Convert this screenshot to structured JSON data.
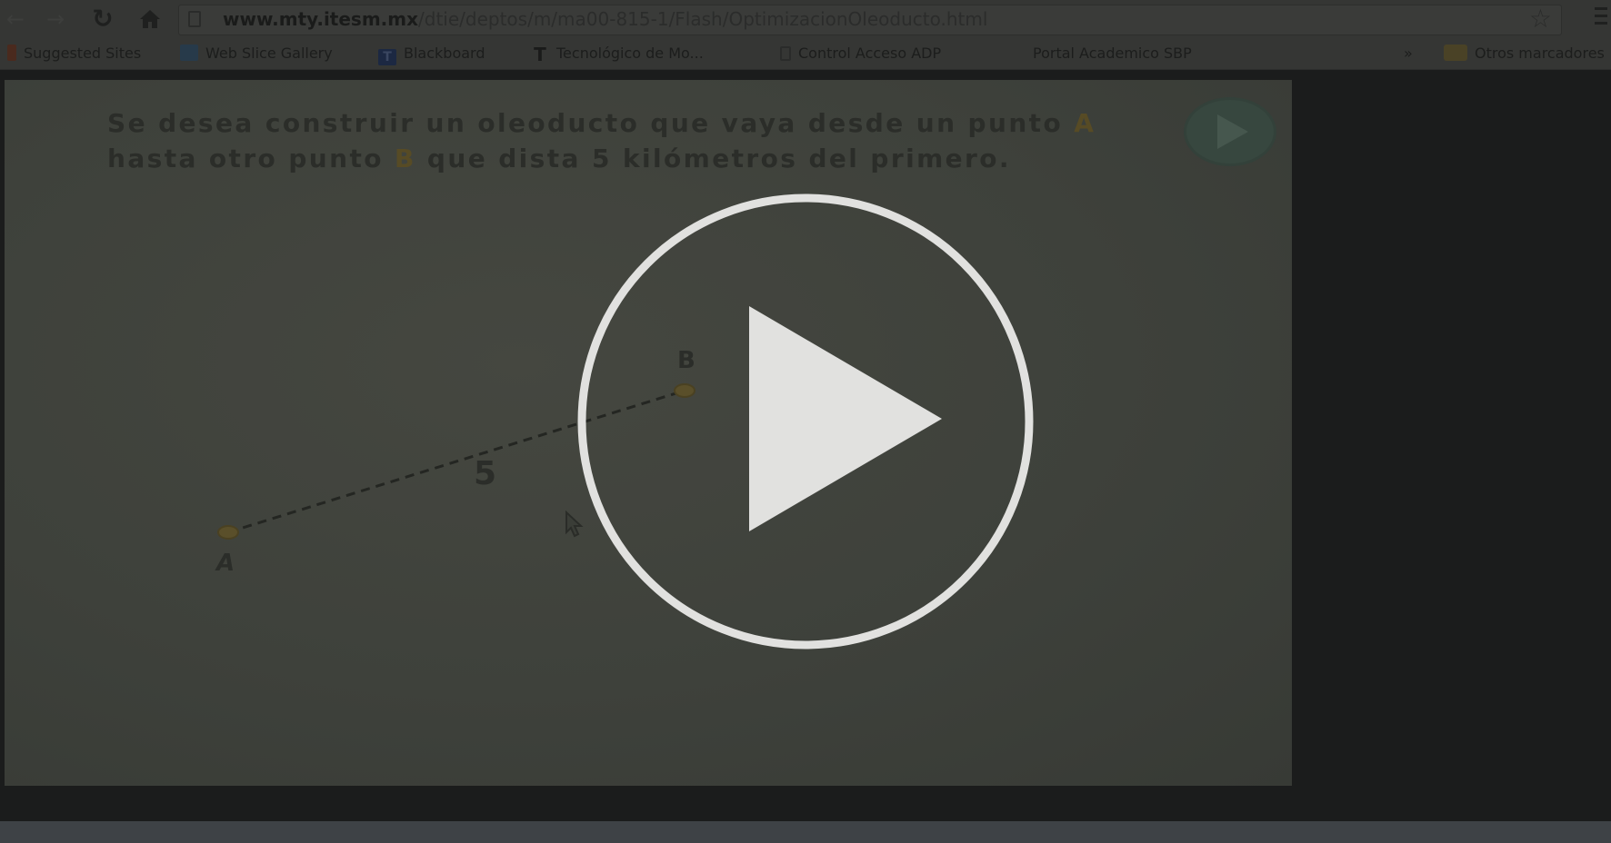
{
  "browser": {
    "url_host": "www.mty.itesm.mx",
    "url_path": "/dtie/deptos/m/ma00-815-1/Flash/OptimizacionOleoducto.html",
    "icons": {
      "back": "back-arrow-icon",
      "forward": "forward-arrow-icon",
      "reload": "reload-icon",
      "home": "home-icon",
      "star": "star-icon",
      "menu": "menu-icon"
    }
  },
  "bookmarks": {
    "items": [
      {
        "label": "Suggested Sites"
      },
      {
        "label": "Web Slice Gallery"
      },
      {
        "label": "Blackboard",
        "icon_text": "T"
      },
      {
        "label": "Tecnológico de Mo...",
        "icon_text": "T"
      },
      {
        "label": "Control Acceso ADP"
      },
      {
        "label": "Portal Academico SBP"
      }
    ],
    "more": "»",
    "others": "Otros marcadores"
  },
  "flash": {
    "problem_part1": "Se desea construir un oleoducto que vaya desde un punto ",
    "point_a_highlight": "A",
    "problem_part2": "hasta otro punto ",
    "point_b_highlight": "B",
    "problem_part3": " que dista 5 kilómetros del primero.",
    "label_a": "A",
    "label_b": "B",
    "distance_label": "5",
    "colors": {
      "point_fill": "#5a4f2a",
      "highlight": "#574b25"
    }
  },
  "overlay": {
    "play_icon": "play-icon",
    "color": "#e1e1df"
  }
}
